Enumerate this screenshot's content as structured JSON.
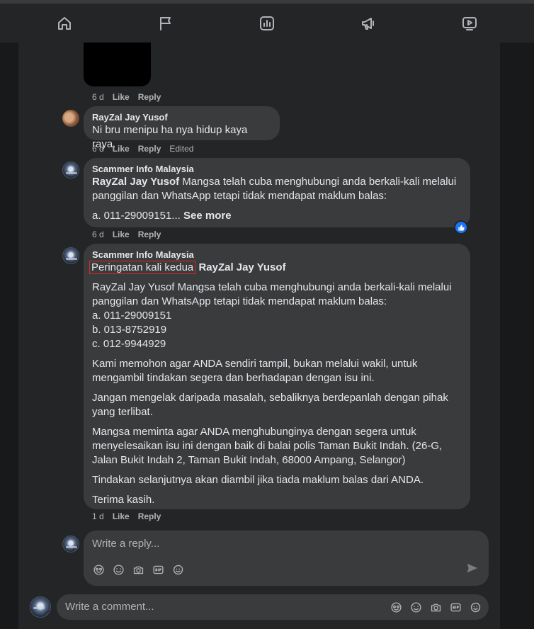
{
  "nav": {
    "icons": [
      "home-icon",
      "flag-icon",
      "chart-icon",
      "megaphone-icon",
      "video-icon"
    ]
  },
  "comments": [
    {
      "actions": {
        "time": "6 d",
        "like": "Like",
        "reply": "Reply"
      }
    },
    {
      "author": "RayZal Jay Yusof",
      "text": "Ni bru menipu ha nya hidup kaya raya.",
      "actions": {
        "time": "6 d",
        "like": "Like",
        "reply": "Reply",
        "edited": "Edited"
      }
    },
    {
      "author": "Scammer Info Malaysia",
      "mention": "RayZal Jay Yusof",
      "text": "Mangsa telah cuba menghubungi anda berkali-kali melalui panggilan dan WhatsApp tetapi tidak mendapat maklum balas:",
      "line2": "a. 011-29009151...",
      "see_more": "See more",
      "actions": {
        "time": "6 d",
        "like": "Like",
        "reply": "Reply"
      }
    },
    {
      "author": "Scammer Info Malaysia",
      "highlight": "Peringatan kali kedua",
      "mention": "RayZal Jay Yusof",
      "paragraphs": [
        "RayZal Jay Yusof Mangsa telah cuba menghubungi anda berkali-kali melalui panggilan dan WhatsApp tetapi tidak mendapat maklum balas:\na. 011-29009151\nb. 013-8752919\nc. 012-9944929",
        "Kami memohon agar ANDA sendiri tampil, bukan melalui wakil, untuk mengambil tindakan segera dan berhadapan dengan isu ini.",
        "Jangan mengelak daripada masalah, sebaliknya berdepanlah dengan pihak yang terlibat.",
        "Mangsa meminta agar ANDA menghubunginya dengan segera untuk menyelesaikan isu ini dengan baik di balai polis Taman Bukit Indah. (26-G, Jalan Bukit Indah 2, Taman Bukit Indah, 68000 Ampang, Selangor)",
        "Tindakan selanjutnya akan diambil jika tiada maklum balas dari ANDA.",
        "Terima kasih."
      ],
      "actions": {
        "time": "1 d",
        "like": "Like",
        "reply": "Reply"
      }
    }
  ],
  "reply_box": {
    "placeholder": "Write a reply..."
  },
  "comment_box": {
    "placeholder": "Write a comment..."
  },
  "composer_icons": [
    "avatar-sticker-icon",
    "emoji-icon",
    "camera-icon",
    "gif-icon",
    "sticker-icon"
  ],
  "colors": {
    "background": "#18191a",
    "panel": "#242526",
    "bubble": "#3a3b3c",
    "accent": "#1877f2",
    "highlight_border": "#e0252b"
  }
}
